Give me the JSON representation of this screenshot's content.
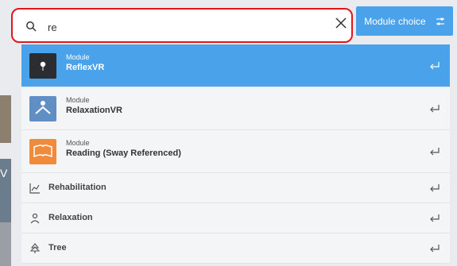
{
  "search": {
    "value": "re",
    "placeholder": ""
  },
  "module_choice_label": "Module choice",
  "results": [
    {
      "kicker": "Module",
      "title": "ReflexVR",
      "icon": "reflexvr-thumbnail",
      "active": true
    },
    {
      "kicker": "Module",
      "title": "RelaxationVR",
      "icon": "relaxationvr-thumbnail"
    },
    {
      "kicker": "Module",
      "title": "Reading (Sway Referenced)",
      "icon": "reading-thumbnail"
    },
    {
      "title": "Rehabilitation",
      "icon": "chart-icon"
    },
    {
      "title": "Relaxation",
      "icon": "person-icon"
    },
    {
      "title": "Tree",
      "icon": "tree-icon"
    }
  ],
  "colors": {
    "accent": "#4aa3ea",
    "highlight": "#e0171b"
  },
  "background_letter": "V"
}
